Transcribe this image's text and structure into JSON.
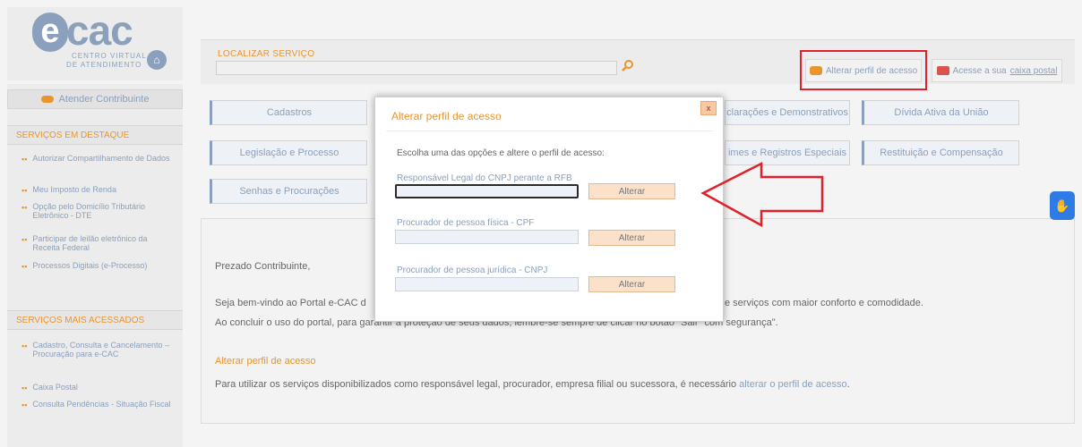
{
  "logo": {
    "e": "e",
    "cac": "cac",
    "subtitle_line1": "CENTRO VIRTUAL",
    "subtitle_line2": "DE ATENDIMENTO",
    "home_icon": "home-icon"
  },
  "search": {
    "label": "LOCALIZAR SERVIÇO",
    "value": "",
    "icon": "search-icon"
  },
  "header_buttons": {
    "perfil": "Alterar perfil de acesso",
    "caixa_prefix": "Acesse a sua ",
    "caixa_link": "caixa postal"
  },
  "sidebar": {
    "atender": "Atender Contribuinte",
    "destaque_title": "SERVIÇOS EM DESTAQUE",
    "destaque_items": [
      "Autorizar Compartilhamento de Dados",
      "Meu Imposto de Renda",
      "Opção pelo Domicílio Tributário Eletrônico - DTE",
      "Participar de leilão eletrônico da Receita Federal",
      "Processos Digitais (e-Processo)"
    ],
    "mais_title": "SERVIÇOS MAIS ACESSADOS",
    "mais_items": [
      "Cadastro, Consulta e Cancelamento – Procuração para e-CAC",
      "Caixa Postal",
      "Consulta Pendências - Situação Fiscal"
    ]
  },
  "categories": {
    "cadastros": "Cadastros",
    "legislacao": "Legislação e Processo",
    "senhas": "Senhas e Procurações",
    "declaracoes": "clarações e Demonstrativos",
    "divida": "Dívida Ativa da União",
    "regimes": "imes e Registros Especiais",
    "restituicao": "Restituição e Compensação"
  },
  "welcome": {
    "title": "Prezado Contribuinte,",
    "line1": "Seja bem-vindo ao Portal e-CAC d",
    "line1_tail": "e serviços com maior conforto e comodidade.",
    "line2": "Ao concluir o uso do portal, para garantir a proteção de seus dados, lembre-se sempre de clicar no botão \"Sair\" com segurança\".",
    "alter_title": "Alterar perfil de acesso",
    "line3_prefix": "Para utilizar os serviços disponibilizados como responsável legal, procurador, empresa filial ou sucessora, é necessário ",
    "line3_link": "alterar o perfil de acesso",
    "line3_suffix": "."
  },
  "modal": {
    "title": "Alterar perfil de acesso",
    "close": "x",
    "instruction": "Escolha uma das opções e altere o perfil de acesso:",
    "options": [
      {
        "label": "Responsável Legal do CNPJ perante a RFB",
        "value": "",
        "button": "Alterar"
      },
      {
        "label": "Procurador de pessoa física - CPF",
        "value": "",
        "button": "Alterar"
      },
      {
        "label": "Procurador de pessoa jurídica - CNPJ",
        "value": "",
        "button": "Alterar"
      }
    ]
  },
  "annotations": {
    "highlight_color": "#e0202a",
    "arrow_color": "#e0202a"
  },
  "accessibility": {
    "icon": "hand-sign-icon",
    "color": "#2f7be6"
  },
  "colors": {
    "accent_orange": "#e8952e",
    "brand_blue": "#8aa0bd"
  }
}
